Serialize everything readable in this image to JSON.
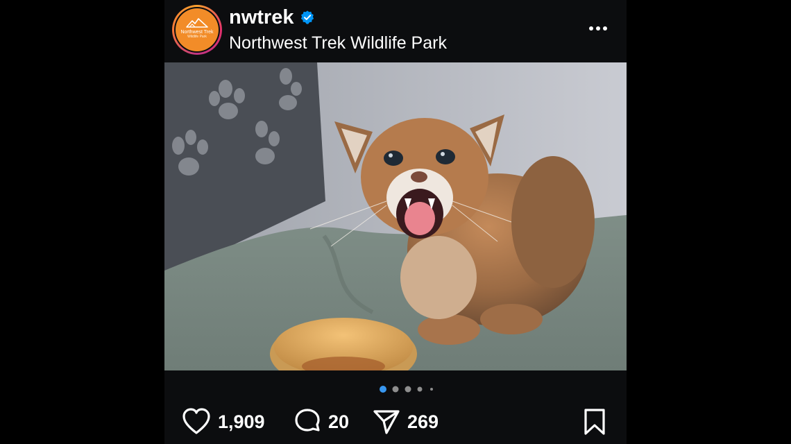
{
  "post": {
    "username": "nwtrek",
    "verified": true,
    "location": "Northwest Trek Wildlife Park",
    "avatar": {
      "logo_text": "Northwest Trek",
      "logo_sub": "Wildlife Park",
      "color": "#f28c28"
    },
    "more_icon": "more-horizontal-icon",
    "carousel": {
      "total": 5,
      "active": 1,
      "active_color": "#3897f0"
    },
    "likes": "1,909",
    "comments": "20",
    "shares": "269",
    "icons": {
      "like": "heart-icon",
      "comment": "comment-bubble-icon",
      "share": "paper-plane-icon",
      "save": "bookmark-icon"
    }
  }
}
